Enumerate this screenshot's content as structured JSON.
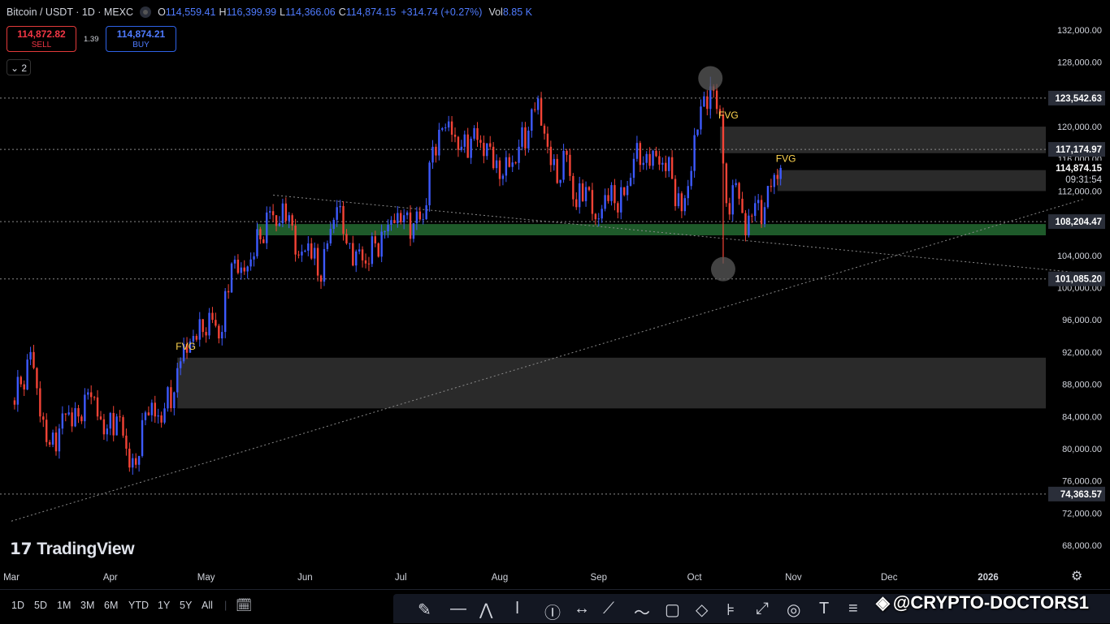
{
  "header": {
    "symbol": "Bitcoin / USDT · 1D · MEXC",
    "open_label": "O",
    "open": "114,559.41",
    "high_label": "H",
    "high": "116,399.99",
    "low_label": "L",
    "low": "114,366.06",
    "close_label": "C",
    "close": "114,874.15",
    "change": "+314.74 (+0.27%)",
    "vol_label": "Vol",
    "vol": "8.85 K"
  },
  "trade": {
    "sell_price": "114,872.82",
    "sell_label": "SELL",
    "spread": "1.39",
    "buy_price": "114,874.21",
    "buy_label": "BUY"
  },
  "collapse_label": "2",
  "logo": {
    "text": "TradingView"
  },
  "chart_data": {
    "type": "candlestick",
    "title": "Bitcoin / USDT · 1D · MEXC",
    "ylim": [
      66000,
      134000
    ],
    "y_ticks": [
      "132,000.00",
      "128,000.00",
      "124,000.00",
      "120,000.00",
      "116,000.00",
      "112,000.00",
      "108,000.00",
      "104,000.00",
      "100,000.00",
      "96,000.00",
      "92,000.00",
      "88,000.00",
      "84,000.00",
      "80,000.00",
      "76,000.00",
      "72,000.00",
      "68,000.00"
    ],
    "x_ticks": [
      "Mar",
      "Apr",
      "May",
      "Jun",
      "Jul",
      "Aug",
      "Sep",
      "Oct",
      "Nov",
      "Dec",
      "2026"
    ],
    "x_tick_dates": [
      "2025-03-01",
      "2025-04-01",
      "2025-05-01",
      "2025-06-01",
      "2025-07-01",
      "2025-08-01",
      "2025-09-01",
      "2025-10-01",
      "2025-11-01",
      "2025-12-01",
      "2026-01-01"
    ],
    "x_range": [
      "2025-03-01",
      "2026-01-31"
    ],
    "closes": [
      [
        "2025-03-01",
        86000
      ],
      [
        "2025-03-04",
        88000
      ],
      [
        "2025-03-07",
        92000
      ],
      [
        "2025-03-10",
        84000
      ],
      [
        "2025-03-13",
        80500
      ],
      [
        "2025-03-16",
        82500
      ],
      [
        "2025-03-19",
        84500
      ],
      [
        "2025-03-22",
        84000
      ],
      [
        "2025-03-25",
        87000
      ],
      [
        "2025-03-28",
        84000
      ],
      [
        "2025-03-31",
        82500
      ],
      [
        "2025-04-03",
        84000
      ],
      [
        "2025-04-06",
        80000
      ],
      [
        "2025-04-09",
        78000
      ],
      [
        "2025-04-12",
        84500
      ],
      [
        "2025-04-15",
        84000
      ],
      [
        "2025-04-18",
        85000
      ],
      [
        "2025-04-21",
        87000
      ],
      [
        "2025-04-24",
        93000
      ],
      [
        "2025-04-27",
        94000
      ],
      [
        "2025-04-30",
        94500
      ],
      [
        "2025-05-03",
        96000
      ],
      [
        "2025-05-06",
        94500
      ],
      [
        "2025-05-09",
        103000
      ],
      [
        "2025-05-12",
        102500
      ],
      [
        "2025-05-15",
        103500
      ],
      [
        "2025-05-18",
        106000
      ],
      [
        "2025-05-21",
        109500
      ],
      [
        "2025-05-24",
        108000
      ],
      [
        "2025-05-27",
        109000
      ],
      [
        "2025-05-30",
        104000
      ],
      [
        "2025-06-02",
        105500
      ],
      [
        "2025-06-05",
        101500
      ],
      [
        "2025-06-08",
        105500
      ],
      [
        "2025-06-11",
        110000
      ],
      [
        "2025-06-14",
        105500
      ],
      [
        "2025-06-17",
        104500
      ],
      [
        "2025-06-20",
        103000
      ],
      [
        "2025-06-23",
        105500
      ],
      [
        "2025-06-26",
        107000
      ],
      [
        "2025-06-29",
        108000
      ],
      [
        "2025-07-02",
        109000
      ],
      [
        "2025-07-05",
        108000
      ],
      [
        "2025-07-08",
        108500
      ],
      [
        "2025-07-11",
        117500
      ],
      [
        "2025-07-14",
        119800
      ],
      [
        "2025-07-17",
        119000
      ],
      [
        "2025-07-20",
        117500
      ],
      [
        "2025-07-23",
        118500
      ],
      [
        "2025-07-26",
        118000
      ],
      [
        "2025-07-29",
        117500
      ],
      [
        "2025-08-01",
        113500
      ],
      [
        "2025-08-04",
        115000
      ],
      [
        "2025-08-07",
        117500
      ],
      [
        "2025-08-10",
        119500
      ],
      [
        "2025-08-13",
        123500
      ],
      [
        "2025-08-16",
        117500
      ],
      [
        "2025-08-19",
        113000
      ],
      [
        "2025-08-22",
        116500
      ],
      [
        "2025-08-25",
        110000
      ],
      [
        "2025-08-28",
        112500
      ],
      [
        "2025-08-31",
        108500
      ],
      [
        "2025-09-03",
        111500
      ],
      [
        "2025-09-06",
        110500
      ],
      [
        "2025-09-09",
        111500
      ],
      [
        "2025-09-12",
        116000
      ],
      [
        "2025-09-15",
        115500
      ],
      [
        "2025-09-18",
        117000
      ],
      [
        "2025-09-21",
        115500
      ],
      [
        "2025-09-24",
        113500
      ],
      [
        "2025-09-27",
        109500
      ],
      [
        "2025-09-30",
        114500
      ],
      [
        "2025-10-03",
        122500
      ],
      [
        "2025-10-06",
        125000
      ],
      [
        "2025-10-09",
        121500
      ],
      [
        "2025-10-11",
        110500
      ],
      [
        "2025-10-14",
        113000
      ],
      [
        "2025-10-17",
        106500
      ],
      [
        "2025-10-20",
        110500
      ],
      [
        "2025-10-23",
        110000
      ],
      [
        "2025-10-26",
        114000
      ],
      [
        "2025-10-28",
        114874.15
      ]
    ],
    "annotations": [
      {
        "type": "zone",
        "label": "FVG",
        "from": "2025-04-22",
        "y": [
          85000,
          91300
        ]
      },
      {
        "type": "zone",
        "label": "FVG",
        "from": "2025-10-09",
        "y": [
          116700,
          120000
        ]
      },
      {
        "type": "zone",
        "label": "FVG",
        "from": "2025-10-27",
        "y": [
          112000,
          114600
        ]
      },
      {
        "type": "zone",
        "from": "2025-05-17",
        "y": [
          106500,
          107900
        ]
      },
      {
        "type": "hline",
        "value": 123542.63,
        "label": "123,542.63"
      },
      {
        "type": "hline",
        "value": 117174.97,
        "label": "117,174.97"
      },
      {
        "type": "hline",
        "value": 108204.47,
        "label": "108,204.47"
      },
      {
        "type": "hline",
        "value": 101085.2,
        "label": "101,085.20"
      },
      {
        "type": "hline",
        "value": 74363.57,
        "label": "74,363.57"
      },
      {
        "type": "trendline",
        "from": [
          "2025-03-01",
          71000
        ],
        "to": [
          "2026-01-31",
          111000
        ]
      },
      {
        "type": "trendline",
        "from": [
          "2025-05-22",
          111500
        ],
        "to": [
          "2026-01-31",
          101800
        ]
      },
      {
        "type": "circle",
        "at": [
          "2025-10-06",
          126000
        ]
      },
      {
        "type": "circle",
        "at": [
          "2025-10-10",
          102300
        ]
      }
    ],
    "last_price": "114,874.15",
    "countdown": "09:31:54",
    "last_price_color": "#ffffff",
    "up_color": "#3d5afe",
    "down_color": "#f44336",
    "zone_color": "#2a2a2a",
    "support_zone_color": "#1e5a2a",
    "grid": false
  },
  "timeframes": [
    "1D",
    "5D",
    "1M",
    "3M",
    "6M",
    "YTD",
    "1Y",
    "5Y",
    "All"
  ],
  "watermark": "@CRYPTO-DOCTORS1"
}
